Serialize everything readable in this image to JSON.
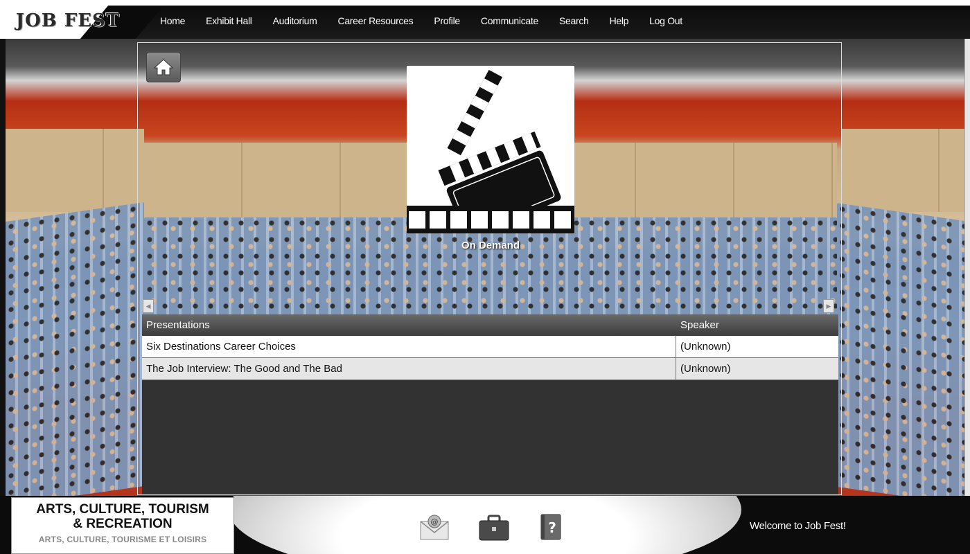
{
  "logo": {
    "text": "JOB FEST"
  },
  "nav": {
    "items": [
      {
        "label": "Home"
      },
      {
        "label": "Exhibit Hall"
      },
      {
        "label": "Auditorium"
      },
      {
        "label": "Career Resources"
      },
      {
        "label": "Profile"
      },
      {
        "label": "Communicate"
      },
      {
        "label": "Search"
      },
      {
        "label": "Help"
      },
      {
        "label": "Log Out"
      }
    ]
  },
  "panel": {
    "home_icon": "home-icon",
    "thumbnail_icon": "clapperboard-icon",
    "thumbnail_label": "On Demand",
    "scroll_left": "◀",
    "scroll_right": "▶"
  },
  "table": {
    "columns": [
      "Presentations",
      "Speaker"
    ],
    "rows": [
      {
        "presentation": "Six Destinations Career Choices",
        "speaker": "(Unknown)"
      },
      {
        "presentation": "The Job Interview: The Good and The Bad",
        "speaker": "(Unknown)"
      }
    ]
  },
  "footer": {
    "category_en_line1": "ARTS, CULTURE, TOURISM",
    "category_en_line2": "& RECREATION",
    "category_fr": "ARTS, CULTURE, TOURISME ET LOISIRS",
    "icons": [
      "mail-icon",
      "briefcase-icon",
      "help-icon"
    ],
    "help_glyph": "?",
    "welcome": "Welcome to Job Fest!"
  },
  "colors": {
    "nav_bg": "#0b0b0b",
    "table_header": "#4a4a4a",
    "row_alt": "#e6e6e6"
  }
}
